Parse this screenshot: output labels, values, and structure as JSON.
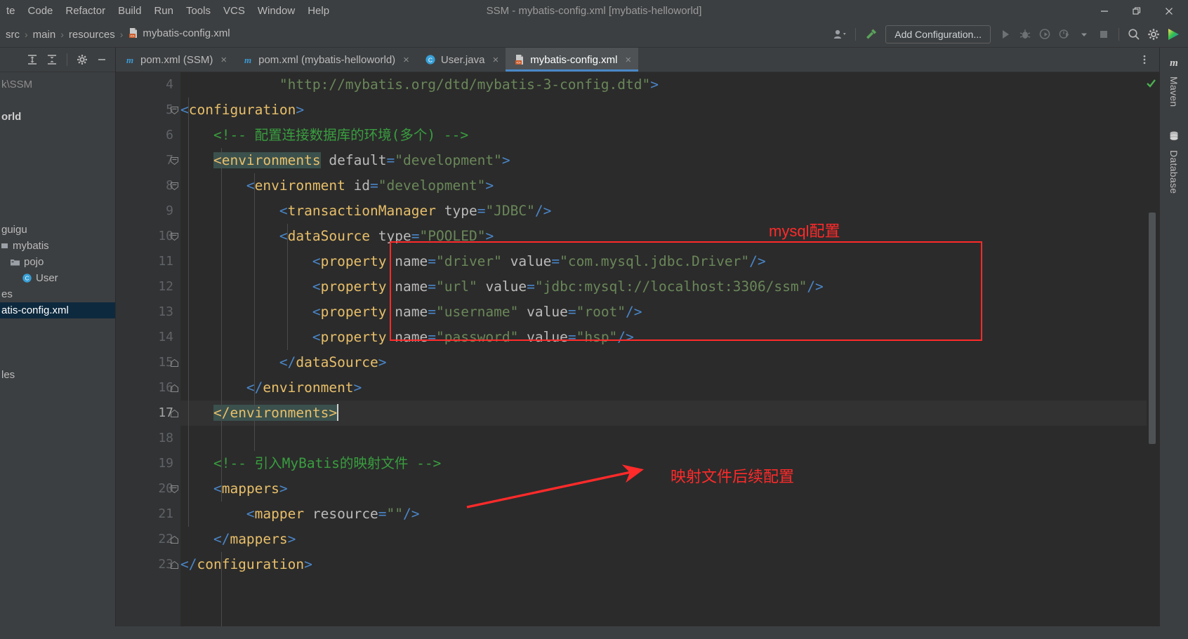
{
  "window": {
    "title": "SSM - mybatis-config.xml [mybatis-helloworld]",
    "minimize_label": "—",
    "maximize_label": "❐",
    "close_label": "✕"
  },
  "menubar": {
    "items": [
      {
        "label": "te",
        "name": "menu-navigate-clipped"
      },
      {
        "label": "Code",
        "name": "menu-code"
      },
      {
        "label": "Refactor",
        "name": "menu-refactor"
      },
      {
        "label": "Build",
        "name": "menu-build"
      },
      {
        "label": "Run",
        "name": "menu-run"
      },
      {
        "label": "Tools",
        "name": "menu-tools"
      },
      {
        "label": "VCS",
        "name": "menu-vcs"
      },
      {
        "label": "Window",
        "name": "menu-window"
      },
      {
        "label": "Help",
        "name": "menu-help"
      }
    ]
  },
  "navbar": {
    "breadcrumbs": [
      "src",
      "main",
      "resources",
      "mybatis-config.xml"
    ],
    "separator": "›",
    "file_icon": "xml-file-icon",
    "add_configuration_label": "Add Configuration...",
    "icons": [
      {
        "name": "user-avatar-dropdown-icon"
      },
      {
        "name": "build-hammer-icon"
      },
      {
        "name": "run-icon"
      },
      {
        "name": "debug-icon"
      },
      {
        "name": "run-with-coverage-icon"
      },
      {
        "name": "profiler-icon"
      },
      {
        "name": "dropdown-arrow-icon"
      },
      {
        "name": "stop-icon"
      },
      {
        "name": "search-everywhere-icon"
      },
      {
        "name": "settings-gear-icon"
      },
      {
        "name": "intellij-idea-logo-icon"
      }
    ]
  },
  "project_panel": {
    "toolbar_icons": [
      {
        "name": "expand-all-icon"
      },
      {
        "name": "collapse-all-icon"
      },
      {
        "name": "project-settings-gear-icon"
      },
      {
        "name": "hide-panel-icon"
      }
    ],
    "tree": [
      {
        "label": "k\\SSM",
        "indent": 0,
        "icon": "none",
        "selected": false,
        "dim": true
      },
      {
        "label": "",
        "indent": 0,
        "icon": "none",
        "selected": false
      },
      {
        "label": "orld",
        "indent": 0,
        "icon": "none",
        "selected": false,
        "bold": true
      },
      {
        "label": "",
        "indent": 0,
        "icon": "none",
        "selected": false
      },
      {
        "label": "",
        "indent": 0,
        "icon": "none",
        "selected": false
      },
      {
        "label": "",
        "indent": 0,
        "icon": "none",
        "selected": false
      },
      {
        "label": "",
        "indent": 0,
        "icon": "none",
        "selected": false
      },
      {
        "label": "",
        "indent": 0,
        "icon": "none",
        "selected": false
      },
      {
        "label": "",
        "indent": 0,
        "icon": "none",
        "selected": false
      },
      {
        "label": "guigu",
        "indent": 0,
        "icon": "none",
        "selected": false
      },
      {
        "label": "mybatis",
        "indent": 0,
        "icon": "package-icon",
        "selected": false
      },
      {
        "label": "pojo",
        "indent": 1,
        "icon": "folder-icon",
        "selected": false
      },
      {
        "label": "User",
        "indent": 2,
        "icon": "java-class-icon",
        "selected": false
      },
      {
        "label": "es",
        "indent": 0,
        "icon": "none",
        "selected": false
      },
      {
        "label": "atis-config.xml",
        "indent": 0,
        "icon": "none",
        "selected": true
      },
      {
        "label": "",
        "indent": 0,
        "icon": "none",
        "selected": false
      },
      {
        "label": "",
        "indent": 0,
        "icon": "none",
        "selected": false
      },
      {
        "label": "",
        "indent": 0,
        "icon": "none",
        "selected": false
      },
      {
        "label": "les",
        "indent": 0,
        "icon": "none",
        "selected": false
      }
    ]
  },
  "tabs": {
    "items": [
      {
        "label": "pom.xml (SSM)",
        "icon": "maven-m-icon",
        "active": false,
        "close": "×"
      },
      {
        "label": "pom.xml (mybatis-helloworld)",
        "icon": "maven-m-icon",
        "active": false,
        "close": "×"
      },
      {
        "label": "User.java",
        "icon": "java-class-icon",
        "active": false,
        "close": "×"
      },
      {
        "label": "mybatis-config.xml",
        "icon": "xml-file-icon",
        "active": true,
        "close": "×"
      }
    ],
    "overflow_icon": "tab-options-icon"
  },
  "editor": {
    "first_line_number": 4,
    "current_line_number": 17,
    "lines": [
      {
        "num": 4,
        "fold": "none",
        "current": false,
        "segments": [
          {
            "t": "            ",
            "c": "at"
          },
          {
            "t": "\"http://mybatis.org/dtd/mybatis-3-config.dtd\"",
            "c": "vl"
          },
          {
            "t": ">",
            "c": "br"
          }
        ]
      },
      {
        "num": 5,
        "fold": "open",
        "current": false,
        "segments": [
          {
            "t": "<",
            "c": "br"
          },
          {
            "t": "configuration",
            "c": "tg"
          },
          {
            "t": ">",
            "c": "br"
          }
        ]
      },
      {
        "num": 6,
        "fold": "none",
        "current": false,
        "segments": [
          {
            "t": "    <!-- 配置连接数据库的环境(多个) -->",
            "c": "cm"
          }
        ]
      },
      {
        "num": 7,
        "fold": "open",
        "current": false,
        "segments": [
          {
            "t": "    ",
            "c": "at"
          },
          {
            "t": "<environments",
            "c": "tg hl"
          },
          {
            "t": " ",
            "c": "at"
          },
          {
            "t": "default",
            "c": "at"
          },
          {
            "t": "=",
            "c": "br"
          },
          {
            "t": "\"development\"",
            "c": "vl"
          },
          {
            "t": ">",
            "c": "br"
          }
        ]
      },
      {
        "num": 8,
        "fold": "open",
        "current": false,
        "segments": [
          {
            "t": "        ",
            "c": "at"
          },
          {
            "t": "<",
            "c": "br"
          },
          {
            "t": "environment",
            "c": "tg"
          },
          {
            "t": " ",
            "c": "at"
          },
          {
            "t": "id",
            "c": "at"
          },
          {
            "t": "=",
            "c": "br"
          },
          {
            "t": "\"development\"",
            "c": "vl"
          },
          {
            "t": ">",
            "c": "br"
          }
        ]
      },
      {
        "num": 9,
        "fold": "none",
        "current": false,
        "segments": [
          {
            "t": "            ",
            "c": "at"
          },
          {
            "t": "<",
            "c": "br"
          },
          {
            "t": "transactionManager",
            "c": "tg"
          },
          {
            "t": " ",
            "c": "at"
          },
          {
            "t": "type",
            "c": "at"
          },
          {
            "t": "=",
            "c": "br"
          },
          {
            "t": "\"JDBC\"",
            "c": "vl"
          },
          {
            "t": "/>",
            "c": "br"
          }
        ]
      },
      {
        "num": 10,
        "fold": "open",
        "current": false,
        "segments": [
          {
            "t": "            ",
            "c": "at"
          },
          {
            "t": "<",
            "c": "br"
          },
          {
            "t": "dataSource",
            "c": "tg"
          },
          {
            "t": " ",
            "c": "at"
          },
          {
            "t": "type",
            "c": "at"
          },
          {
            "t": "=",
            "c": "br"
          },
          {
            "t": "\"POOLED\"",
            "c": "vl"
          },
          {
            "t": ">",
            "c": "br"
          }
        ]
      },
      {
        "num": 11,
        "fold": "none",
        "current": false,
        "segments": [
          {
            "t": "                ",
            "c": "at"
          },
          {
            "t": "<",
            "c": "br"
          },
          {
            "t": "property",
            "c": "tg"
          },
          {
            "t": " ",
            "c": "at"
          },
          {
            "t": "name",
            "c": "at"
          },
          {
            "t": "=",
            "c": "br"
          },
          {
            "t": "\"driver\"",
            "c": "vl"
          },
          {
            "t": " ",
            "c": "at"
          },
          {
            "t": "value",
            "c": "at"
          },
          {
            "t": "=",
            "c": "br"
          },
          {
            "t": "\"com.mysql.jdbc.Driver\"",
            "c": "vl"
          },
          {
            "t": "/>",
            "c": "br"
          }
        ]
      },
      {
        "num": 12,
        "fold": "none",
        "current": false,
        "segments": [
          {
            "t": "                ",
            "c": "at"
          },
          {
            "t": "<",
            "c": "br"
          },
          {
            "t": "property",
            "c": "tg"
          },
          {
            "t": " ",
            "c": "at"
          },
          {
            "t": "name",
            "c": "at"
          },
          {
            "t": "=",
            "c": "br"
          },
          {
            "t": "\"url\"",
            "c": "vl"
          },
          {
            "t": " ",
            "c": "at"
          },
          {
            "t": "value",
            "c": "at"
          },
          {
            "t": "=",
            "c": "br"
          },
          {
            "t": "\"jdbc:mysql://localhost:3306/ssm\"",
            "c": "vl"
          },
          {
            "t": "/>",
            "c": "br"
          }
        ]
      },
      {
        "num": 13,
        "fold": "none",
        "current": false,
        "segments": [
          {
            "t": "                ",
            "c": "at"
          },
          {
            "t": "<",
            "c": "br"
          },
          {
            "t": "property",
            "c": "tg"
          },
          {
            "t": " ",
            "c": "at"
          },
          {
            "t": "name",
            "c": "at"
          },
          {
            "t": "=",
            "c": "br"
          },
          {
            "t": "\"username\"",
            "c": "vl"
          },
          {
            "t": " ",
            "c": "at"
          },
          {
            "t": "value",
            "c": "at"
          },
          {
            "t": "=",
            "c": "br"
          },
          {
            "t": "\"root\"",
            "c": "vl"
          },
          {
            "t": "/>",
            "c": "br"
          }
        ]
      },
      {
        "num": 14,
        "fold": "none",
        "current": false,
        "segments": [
          {
            "t": "                ",
            "c": "at"
          },
          {
            "t": "<",
            "c": "br"
          },
          {
            "t": "property",
            "c": "tg"
          },
          {
            "t": " ",
            "c": "at"
          },
          {
            "t": "name",
            "c": "at"
          },
          {
            "t": "=",
            "c": "br"
          },
          {
            "t": "\"password\"",
            "c": "vl"
          },
          {
            "t": " ",
            "c": "at"
          },
          {
            "t": "value",
            "c": "at"
          },
          {
            "t": "=",
            "c": "br"
          },
          {
            "t": "\"hsp\"",
            "c": "vl"
          },
          {
            "t": "/>",
            "c": "br"
          }
        ]
      },
      {
        "num": 15,
        "fold": "close",
        "current": false,
        "segments": [
          {
            "t": "            ",
            "c": "at"
          },
          {
            "t": "</",
            "c": "br"
          },
          {
            "t": "dataSource",
            "c": "tg"
          },
          {
            "t": ">",
            "c": "br"
          }
        ]
      },
      {
        "num": 16,
        "fold": "close",
        "current": false,
        "segments": [
          {
            "t": "        ",
            "c": "at"
          },
          {
            "t": "</",
            "c": "br"
          },
          {
            "t": "environment",
            "c": "tg"
          },
          {
            "t": ">",
            "c": "br"
          }
        ]
      },
      {
        "num": 17,
        "fold": "close",
        "current": true,
        "segments": [
          {
            "t": "    ",
            "c": "at"
          },
          {
            "t": "</environments>",
            "c": "tg hl"
          }
        ]
      },
      {
        "num": 18,
        "fold": "none",
        "current": false,
        "segments": []
      },
      {
        "num": 19,
        "fold": "none",
        "current": false,
        "segments": [
          {
            "t": "    <!-- 引入MyBatis的映射文件 -->",
            "c": "cm"
          }
        ]
      },
      {
        "num": 20,
        "fold": "open",
        "current": false,
        "segments": [
          {
            "t": "    ",
            "c": "at"
          },
          {
            "t": "<",
            "c": "br"
          },
          {
            "t": "mappers",
            "c": "tg"
          },
          {
            "t": ">",
            "c": "br"
          }
        ]
      },
      {
        "num": 21,
        "fold": "none",
        "current": false,
        "segments": [
          {
            "t": "        ",
            "c": "at"
          },
          {
            "t": "<",
            "c": "br"
          },
          {
            "t": "mapper",
            "c": "tg"
          },
          {
            "t": " ",
            "c": "at"
          },
          {
            "t": "resource",
            "c": "at"
          },
          {
            "t": "=",
            "c": "br"
          },
          {
            "t": "\"\"",
            "c": "vl"
          },
          {
            "t": "/>",
            "c": "br"
          }
        ]
      },
      {
        "num": 22,
        "fold": "close",
        "current": false,
        "segments": [
          {
            "t": "    ",
            "c": "at"
          },
          {
            "t": "</",
            "c": "br"
          },
          {
            "t": "mappers",
            "c": "tg"
          },
          {
            "t": ">",
            "c": "br"
          }
        ]
      },
      {
        "num": 23,
        "fold": "close",
        "current": false,
        "segments": [
          {
            "t": "",
            "c": "at"
          },
          {
            "t": "</",
            "c": "br"
          },
          {
            "t": "configuration",
            "c": "tg"
          },
          {
            "t": ">",
            "c": "br"
          }
        ]
      }
    ]
  },
  "annotations": {
    "accent_color": "#ff2a2a",
    "mysql_label": "mysql配置",
    "mapper_label": "映射文件后续配置",
    "red_box_name": "mysql-config-highlight-box",
    "arrow_name": "mapper-annotation-arrow"
  },
  "inspection": {
    "status_icon": "inspection-ok-checkmark",
    "status_color": "#4caf50"
  },
  "right_tool_window": {
    "items": [
      {
        "label": "Maven",
        "icon": "maven-m-icon"
      },
      {
        "label": "Database",
        "icon": "database-icon"
      }
    ]
  }
}
